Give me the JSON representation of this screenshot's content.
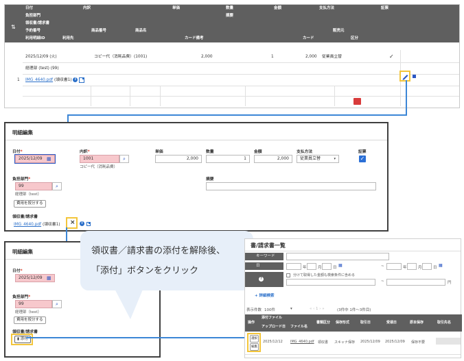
{
  "top_table": {
    "headers_row1": [
      "日付",
      "内訳",
      "単価",
      "数量",
      "金額",
      "支払方法",
      "証票"
    ],
    "headers_row2": [
      "負担部門",
      "摘要"
    ],
    "headers_row3": [
      "領収書/請求書"
    ],
    "headers_row4": [
      "予約番号",
      "商品番号",
      "商品名",
      "販売元"
    ],
    "headers_row5": [
      "利用明細ID",
      "利用先",
      "カード備考",
      "カード",
      "区分"
    ],
    "row": {
      "number": "1",
      "date": "2025/12/09 (火)",
      "item": "コピー代（消耗品費）(1001)",
      "unit_price": "2,000",
      "quantity": "1",
      "amount": "2,000",
      "payment": "従業員立替",
      "voucher_mark": "✓",
      "dept": "経理部 (test) (99)",
      "file_link": "IMG_4640.pdf",
      "file_note": "(領収書1)"
    }
  },
  "edit_panel_1": {
    "title": "明細編集",
    "date_label": "日付",
    "date_value": "2025/12/09",
    "item_label": "内訳",
    "item_code": "1001",
    "item_name": "コピー代（消耗品費）",
    "unit_price_label": "単価",
    "unit_price_value": "2,000",
    "quantity_label": "数量",
    "quantity_value": "1",
    "amount_label": "金額",
    "amount_value": "2,000",
    "payment_label": "支払方法",
    "payment_value": "従業員立替",
    "voucher_label": "証票",
    "dept_label": "負担部門",
    "dept_code": "99",
    "dept_name": "経理部（test）",
    "split_button": "費用を按分する",
    "memo_label": "摘要",
    "receipt_label": "領収書/請求書",
    "file_link": "IMG_4640.pdf",
    "file_note": "(領収書1)"
  },
  "edit_panel_2": {
    "title": "明細編集",
    "date_label": "日付",
    "date_value": "2025/12/09",
    "dept_label": "負担部門",
    "dept_code": "99",
    "dept_name": "経理部（test）",
    "split_button": "費用を按分する",
    "receipt_label": "領収書/請求書",
    "attach_button": "添付"
  },
  "bubble": {
    "line1": "領収書／請求書の添付を解除後、",
    "line2": "「添付」ボタンをクリック"
  },
  "list_panel": {
    "title": "書/請求書一覧",
    "keyword_label": "キーワード",
    "date_label": "日",
    "year_unit": "年",
    "month_unit": "月",
    "day_unit": "日",
    "range_sep": "~",
    "yen_unit": "円",
    "amount_check_label": "分けて取得した金額も検索条件に含める",
    "detail_search": "+ 詳細検索",
    "display_count_label": "表示件数",
    "display_count_value": "100件",
    "result_count": "(3件中 1件～3件目)",
    "col_op": "操作",
    "col_attach_group": "添付ファイル",
    "col_upload_date": "アップロード日",
    "col_file_name": "ファイル名",
    "col_doc_type": "書類区分",
    "col_save_method": "保存形式",
    "col_receipt_date": "取引日",
    "col_received_date": "受領日",
    "col_storage": "原本保存",
    "col_vendor": "取引先名",
    "op_select": "選択",
    "op_edit": "編集",
    "row_upload_date": "2025/12/12",
    "row_file_name": "IMG_4640.pdf",
    "row_doc_type": "領収書",
    "row_save_method": "スキャナ保存",
    "row_receipt_date": "2025/12/09",
    "row_received_date": "2025/12/09",
    "row_storage": "保存不要"
  }
}
